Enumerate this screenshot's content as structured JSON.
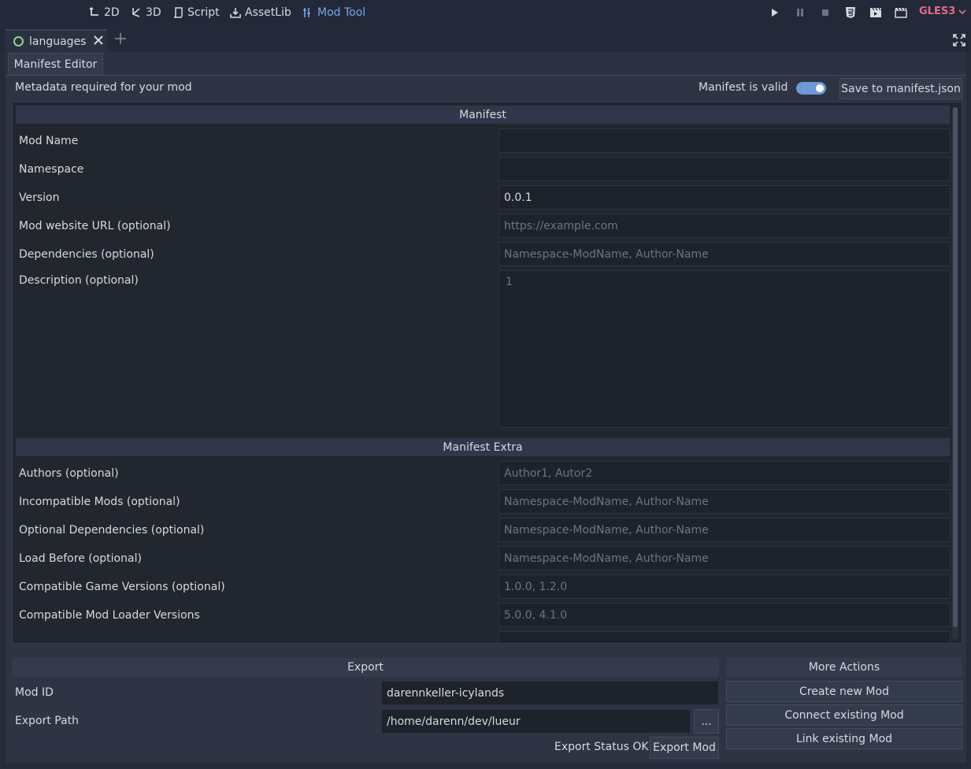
{
  "toolbar": {
    "workspaces": [
      {
        "label": "2D",
        "icon": "2d-icon"
      },
      {
        "label": "3D",
        "icon": "3d-icon"
      },
      {
        "label": "Script",
        "icon": "script-icon"
      },
      {
        "label": "AssetLib",
        "icon": "assetlib-icon"
      },
      {
        "label": "Mod Tool",
        "icon": "mod-tool-icon",
        "active": true
      }
    ],
    "renderer": "GLES3",
    "accent_color": "#75a7f0",
    "renderer_color": "#e26b8f"
  },
  "tabs": {
    "scene_tab": "languages"
  },
  "editor": {
    "tab_label": "Manifest Editor",
    "metadata_label": "Metadata required for your mod",
    "valid_label": "Manifest is valid",
    "valid_toggle": true,
    "save_button": "Save to manifest.json"
  },
  "manifest": {
    "title": "Manifest",
    "fields": [
      {
        "label": "Mod Name",
        "value": "",
        "placeholder": ""
      },
      {
        "label": "Namespace",
        "value": "",
        "placeholder": ""
      },
      {
        "label": "Version",
        "value": "0.0.1",
        "placeholder": ""
      },
      {
        "label": "Mod website URL (optional)",
        "value": "",
        "placeholder": "https://example.com"
      },
      {
        "label": "Dependencies (optional)",
        "value": "",
        "placeholder": "Namespace-ModName, Author-Name"
      }
    ],
    "description_label": "Description (optional)",
    "description_line": "1"
  },
  "manifest_extra": {
    "title": "Manifest Extra",
    "fields": [
      {
        "label": "Authors (optional)",
        "value": "",
        "placeholder": "Author1, Autor2"
      },
      {
        "label": "Incompatible Mods (optional)",
        "value": "",
        "placeholder": "Namespace-ModName, Author-Name"
      },
      {
        "label": "Optional Dependencies (optional)",
        "value": "",
        "placeholder": "Namespace-ModName, Author-Name"
      },
      {
        "label": "Load Before (optional)",
        "value": "",
        "placeholder": "Namespace-ModName, Author-Name"
      },
      {
        "label": "Compatible Game Versions (optional)",
        "value": "",
        "placeholder": "1.0.0, 1.2.0"
      },
      {
        "label": "Compatible Mod Loader Versions",
        "value": "",
        "placeholder": "5.0.0, 4.1.0"
      }
    ]
  },
  "export": {
    "title": "Export",
    "mod_id_label": "Mod ID",
    "mod_id_value": "darennkeller-icylands",
    "path_label": "Export Path",
    "path_value": "/home/darenn/dev/lueur",
    "browse_label": "...",
    "status": "Export Status OK",
    "export_button": "Export Mod"
  },
  "more_actions": {
    "title": "More Actions",
    "buttons": [
      "Create new Mod",
      "Connect existing Mod",
      "Link existing Mod"
    ]
  }
}
